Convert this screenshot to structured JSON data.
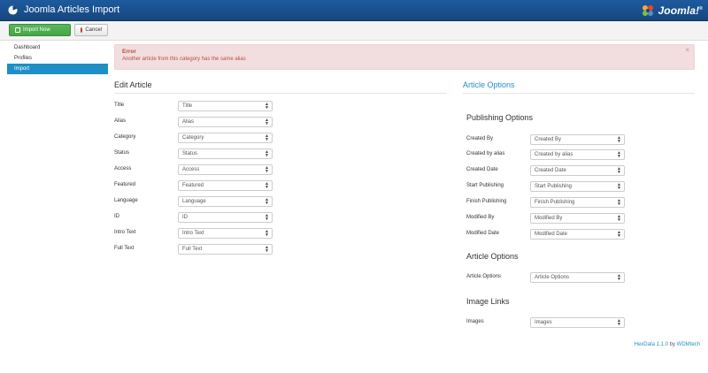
{
  "header": {
    "title": "Joomla Articles Import",
    "logo_text": "Joomla!",
    "logo_registered": "®",
    "icons": {
      "app": "dashboard-icon",
      "logo": "joomla-logo-icon"
    },
    "colors": {
      "bar": "#1d5b9e"
    }
  },
  "toolbar": {
    "import_label": "Import Now",
    "cancel_label": "Cancel",
    "icons": {
      "import": "edit-icon",
      "cancel": "cancel-circle-icon"
    },
    "colors": {
      "import": "#5bb75b",
      "cancel_icon": "#c9302c"
    }
  },
  "sidebar": {
    "items": [
      {
        "label": "Dashboard",
        "active": false
      },
      {
        "label": "Profiles",
        "active": false
      },
      {
        "label": "Import",
        "active": true
      }
    ],
    "colors": {
      "active": "#1e8fc6"
    }
  },
  "alert": {
    "title": "Error",
    "message": "Another article from this category has the same alias",
    "close": "×",
    "colors": {
      "bg": "#f2dede",
      "text": "#b94a48"
    }
  },
  "edit_article": {
    "heading": "Edit Article",
    "fields": [
      {
        "label": "Title",
        "value": "Title"
      },
      {
        "label": "Alias",
        "value": "Alias"
      },
      {
        "label": "Category",
        "value": "Category"
      },
      {
        "label": "Status",
        "value": "Status"
      },
      {
        "label": "Access",
        "value": "Access"
      },
      {
        "label": "Featured",
        "value": "Featured"
      },
      {
        "label": "Language",
        "value": "Language"
      },
      {
        "label": "ID",
        "value": "ID"
      },
      {
        "label": "Intro Text",
        "value": "Intro Text"
      },
      {
        "label": "Full Text",
        "value": "Full Text"
      }
    ]
  },
  "article_options": {
    "heading": "Article Options",
    "publishing": {
      "heading": "Publishing Options",
      "fields": [
        {
          "label": "Created By",
          "value": "Created By"
        },
        {
          "label": "Created by alias",
          "value": "Created by alias"
        },
        {
          "label": "Created Date",
          "value": "Created Date"
        },
        {
          "label": "Start Publishing",
          "value": "Start Publishing"
        },
        {
          "label": "Finish Publishing",
          "value": "Finish Publishing"
        },
        {
          "label": "Modified By",
          "value": "Modified By"
        },
        {
          "label": "Modified Date",
          "value": "Modified Date"
        }
      ]
    },
    "options": {
      "heading": "Article Options",
      "fields": [
        {
          "label": "Article Options",
          "value": "Article Options"
        }
      ]
    },
    "images": {
      "heading": "Image Links",
      "fields": [
        {
          "label": "Images",
          "value": "Images"
        }
      ]
    }
  },
  "footer": {
    "product": "HexData 1.1.0",
    "by": "by",
    "vendor": "WDMtech"
  }
}
